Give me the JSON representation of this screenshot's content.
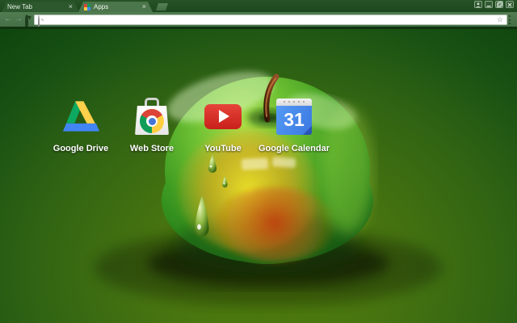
{
  "window": {
    "controls": [
      {
        "name": "profile",
        "icon": "person-icon"
      },
      {
        "name": "minimize",
        "icon": "minimize-icon"
      },
      {
        "name": "maximize",
        "icon": "maximize-icon"
      },
      {
        "name": "close",
        "icon": "close-icon"
      }
    ]
  },
  "tabs": [
    {
      "label": "New Tab",
      "active": false,
      "close_glyph": "×"
    },
    {
      "label": "Apps",
      "active": true,
      "favicon": "apps-grid-icon",
      "close_glyph": "×"
    }
  ],
  "toolbar": {
    "back_glyph": "←",
    "forward_glyph": "→",
    "reload_icon": "reload-icon",
    "omnibox_value": "",
    "omnibox_placeholder": "",
    "search_icon": "magnifier-icon",
    "bookmark_glyph": "☆",
    "menu_icon": "three-dot-menu-icon"
  },
  "shortcuts": [
    {
      "label": "Google Drive",
      "icon": "google-drive-icon"
    },
    {
      "label": "Web Store",
      "icon": "chrome-web-store-icon"
    },
    {
      "label": "YouTube",
      "icon": "youtube-icon"
    },
    {
      "label": "Google Calendar",
      "icon": "google-calendar-icon",
      "day": "31"
    }
  ],
  "theme": {
    "name": "green apple chrome theme",
    "frame_color": "#1d471d",
    "toolbar_color": "#4b764b",
    "inactive_tab_color": "#2d572d",
    "page_center_color": "#4f7c0b",
    "page_edge_color": "#0c430c",
    "wallpaper": "glossy green apple with orange blush, stem and water droplets"
  },
  "brand_colors": {
    "google_red": "#db4437",
    "google_green": "#0f9d58",
    "google_yellow": "#ffcd40",
    "google_blue": "#4285f4",
    "youtube_red": "#e62117"
  }
}
